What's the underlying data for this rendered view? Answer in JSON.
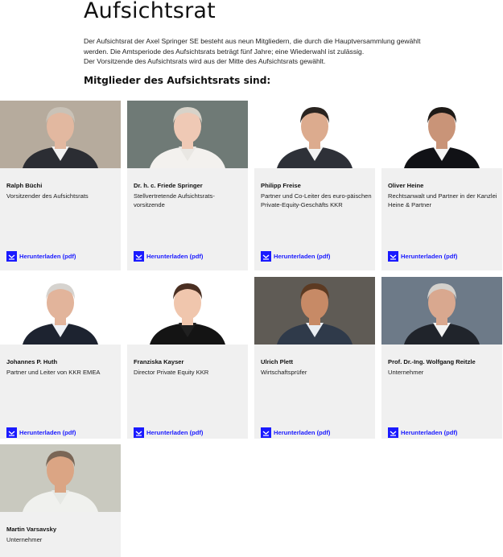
{
  "page": {
    "title": "Aufsichtsrat",
    "intro": [
      "Der Aufsichtsrat der Axel Springer SE besteht aus neun Mitgliedern, die durch die Hauptversammlung gewählt werden. Die Amtsperiode des Aufsichtsrats beträgt fünf Jahre; eine Wiederwahl ist zulässig.",
      "Der Vorsitzende des Aufsichtsrats wird aus der Mitte des Aufsichtsrats gewählt."
    ],
    "members_heading": "Mitglieder des Aufsichtsrats sind:"
  },
  "accent_color": "#1a1aff",
  "download_icon": "download-icon",
  "members": [
    {
      "name": "Ralph Büchi",
      "role": "Vorsitzender des Aufsichtsrats",
      "download_label": "Herunterladen (pdf)"
    },
    {
      "name": "Dr. h. c. Friede Springer",
      "role": "Stellvertretende Aufsichtsrats-vorsitzende",
      "download_label": "Herunterladen (pdf)"
    },
    {
      "name": "Philipp Freise",
      "role": "Partner und Co-Leiter des euro-päischen Private-Equity-Geschäfts KKR",
      "download_label": "Herunterladen (pdf)"
    },
    {
      "name": "Oliver Heine",
      "role": "Rechtsanwalt und Partner in der Kanzlei Heine & Partner",
      "download_label": "Herunterladen (pdf)"
    },
    {
      "name": "Johannes P. Huth",
      "role": "Partner und Leiter von KKR EMEA",
      "download_label": "Herunterladen (pdf)"
    },
    {
      "name": "Franziska Kayser",
      "role": "Director Private Equity KKR",
      "download_label": "Herunterladen (pdf)"
    },
    {
      "name": "Ulrich Plett",
      "role": "Wirtschaftsprüfer",
      "download_label": "Herunterladen (pdf)"
    },
    {
      "name": "Prof. Dr.-Ing. Wolfgang Reitzle",
      "role": "Unternehmer",
      "download_label": "Herunterladen (pdf)"
    },
    {
      "name": "Martin Varsavsky",
      "role": "Unternehmer",
      "download_label": ""
    }
  ]
}
